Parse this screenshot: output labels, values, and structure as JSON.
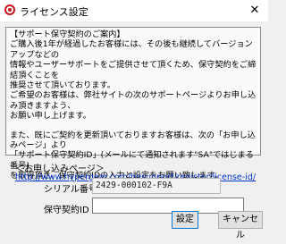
{
  "window": {
    "title": "ライセンス設定",
    "close_glyph": "✕",
    "icon": "app-logo-icon"
  },
  "notice": {
    "lines": [
      "【サポート保守契約のご案内】",
      "ご購入後1年が経過したお客様には、その後も継続してバージョンアップなどの",
      "情報やユーザーサポートをご提供させて頂くため、保守契約をご締結頂くことを",
      "推奨させて頂いております。",
      "ご希望のお客様は、弊社サイトの次のサポートページよりお申し込み頂きますよう、",
      "お願い申し上げます。",
      "また、既にご契約を更新頂いておりますお客様は、次の「お申し込みページ」より",
      "「サポート保守契約ID」(メールにて通知されます\"SA\"ではじまる番号)",
      "を取得頂き、保守契約IDの入力と設定をお願い致します。"
    ]
  },
  "apply": {
    "label": "＜お申し込みページ＞",
    "url": "http://www.hypergear.com/hgsupport/register/license-id/"
  },
  "form": {
    "serial_label": "シリアル番号",
    "serial_value": "2429-000102-F9A",
    "contract_label": "保守契約ID",
    "contract_value": ""
  },
  "buttons": {
    "ok": "設定",
    "cancel": "キャンセル"
  }
}
